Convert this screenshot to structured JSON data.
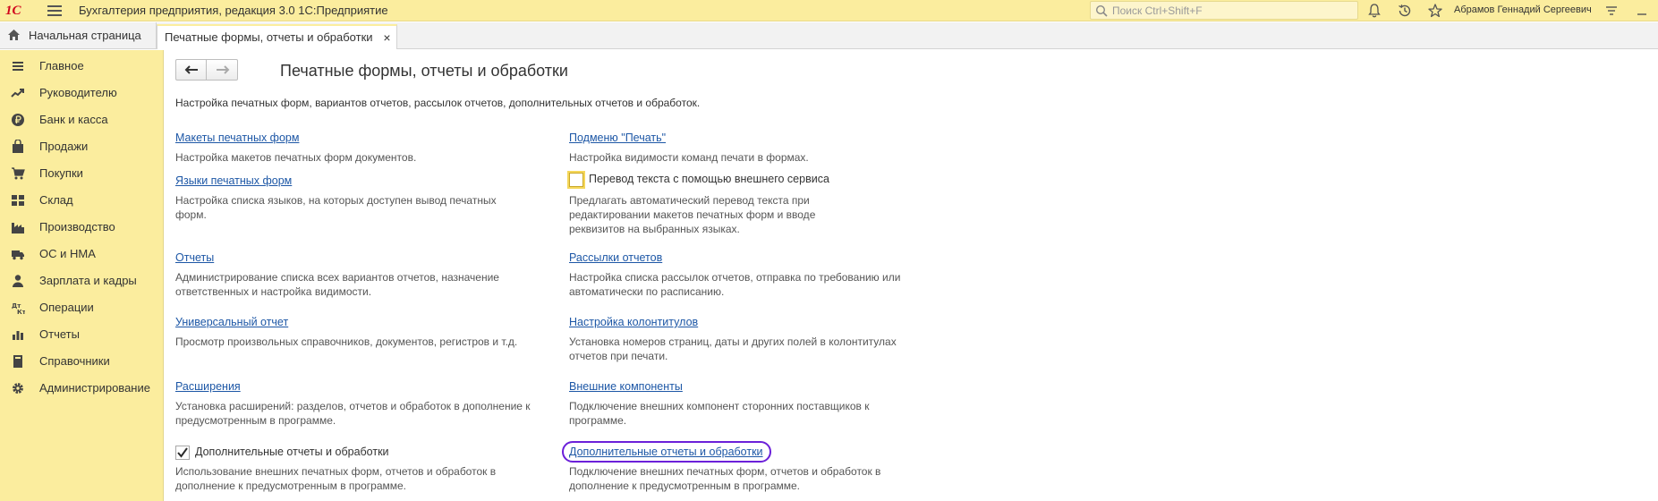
{
  "app": {
    "title": "Бухгалтерия предприятия, редакция 3.0 1С:Предприятие",
    "logo_text": "1С",
    "search_placeholder": "Поиск Ctrl+Shift+F",
    "user_name": "Абрамов Геннадий Сергеевич"
  },
  "tabs": {
    "home": "Начальная страница",
    "active": "Печатные формы, отчеты и обработки",
    "close_glyph": "×"
  },
  "sidebar": {
    "items": [
      {
        "label": "Главное",
        "icon": "menu-lines-icon"
      },
      {
        "label": "Руководителю",
        "icon": "trend-icon"
      },
      {
        "label": "Банк и касса",
        "icon": "ruble-coin-icon"
      },
      {
        "label": "Продажи",
        "icon": "bag-icon"
      },
      {
        "label": "Покупки",
        "icon": "cart-icon"
      },
      {
        "label": "Склад",
        "icon": "warehouse-icon"
      },
      {
        "label": "Производство",
        "icon": "factory-icon"
      },
      {
        "label": "ОС и НМА",
        "icon": "truck-icon"
      },
      {
        "label": "Зарплата и кадры",
        "icon": "person-icon"
      },
      {
        "label": "Операции",
        "icon": "dt-kt-icon"
      },
      {
        "label": "Отчеты",
        "icon": "bar-chart-icon"
      },
      {
        "label": "Справочники",
        "icon": "books-icon"
      },
      {
        "label": "Администрирование",
        "icon": "gear-icon"
      }
    ]
  },
  "main": {
    "title": "Печатные формы, отчеты и обработки",
    "intro": "Настройка печатных форм, вариантов отчетов, рассылок отчетов, дополнительных отчетов и обработок.",
    "left": {
      "print_layouts": {
        "link": "Макеты печатных форм",
        "desc": "Настройка макетов печатных форм документов."
      },
      "print_languages": {
        "link": "Языки печатных форм",
        "desc": "Настройка списка языков, на которых доступен вывод печатных форм."
      },
      "reports": {
        "link": "Отчеты",
        "desc": "Администрирование списка всех вариантов отчетов, назначение ответственных и настройка видимости."
      },
      "universal_report": {
        "link": "Универсальный отчет",
        "desc": "Просмотр произвольных справочников, документов, регистров и т.д."
      },
      "extensions": {
        "link": "Расширения",
        "desc": "Установка расширений: разделов, отчетов и обработок в дополнение к предусмотренным в программе."
      },
      "additional": {
        "label": "Дополнительные отчеты и обработки",
        "checked": true,
        "desc": "Использование внешних печатных форм, отчетов и обработок в дополнение к предусмотренным в программе."
      }
    },
    "right": {
      "print_submenu": {
        "link": "Подменю \"Печать\"",
        "desc": "Настройка видимости команд печати в формах."
      },
      "translation": {
        "label": "Перевод текста с помощью внешнего сервиса",
        "checked": false,
        "desc": "Предлагать автоматический перевод текста при редактировании макетов печатных форм и вводе реквизитов на выбранных языках."
      },
      "mailings": {
        "link": "Рассылки отчетов",
        "desc": "Настройка списка рассылок отчетов, отправка по требованию или автоматически по расписанию."
      },
      "headers": {
        "link": "Настройка колонтитулов",
        "desc": "Установка номеров страниц, даты и других полей в колонтитулах отчетов при печати."
      },
      "components": {
        "link": "Внешние компоненты",
        "desc": "Подключение внешних компонент сторонних поставщиков к программе."
      },
      "additional": {
        "link": "Дополнительные отчеты и обработки",
        "desc": "Подключение внешних печатных форм, отчетов и обработок в дополнение к предусмотренным в программе."
      }
    }
  },
  "colors": {
    "accent_yellow": "#fbed9e",
    "link_blue": "#1d57a6",
    "highlight_purple": "#6b20d9"
  }
}
